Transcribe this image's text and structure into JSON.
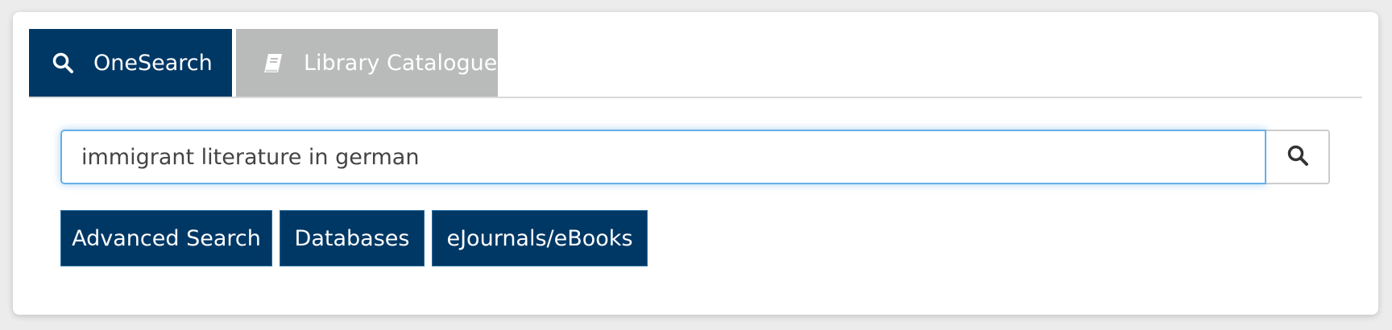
{
  "tabs": [
    {
      "label": "OneSearch",
      "icon": "search-icon",
      "active": true
    },
    {
      "label": "Library Catalogue",
      "icon": "book-icon",
      "active": false
    }
  ],
  "search": {
    "value": "immigrant literature in german",
    "button_icon": "search-icon"
  },
  "quick_links": [
    {
      "label": "Advanced Search"
    },
    {
      "label": "Databases"
    },
    {
      "label": "eJournals/eBooks"
    }
  ],
  "colors": {
    "primary": "#003865",
    "inactive_tab": "#b9baba",
    "focus_border": "#66afe9",
    "background": "#ececec"
  }
}
